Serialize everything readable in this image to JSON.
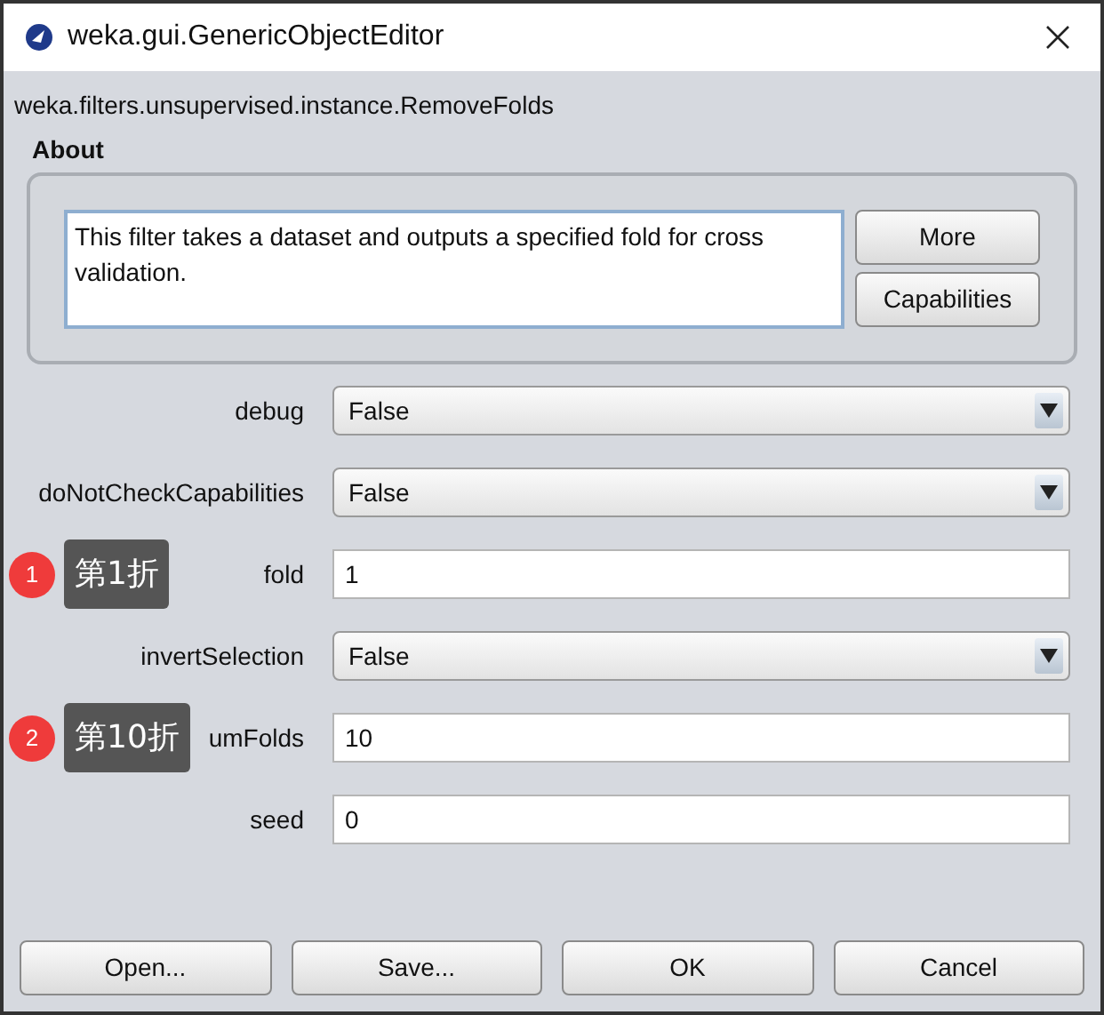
{
  "window": {
    "title": "weka.gui.GenericObjectEditor"
  },
  "class_name": "weka.filters.unsupervised.instance.RemoveFolds",
  "about": {
    "heading": "About",
    "description": "This filter takes a dataset and outputs a specified fold for cross validation.",
    "buttons": [
      "More",
      "Capabilities"
    ]
  },
  "properties": [
    {
      "label": "debug",
      "kind": "dropdown",
      "value": "False"
    },
    {
      "label": "doNotCheckCapabilities",
      "kind": "dropdown",
      "value": "False"
    },
    {
      "label": "fold",
      "kind": "text",
      "value": "1",
      "annotation": {
        "number": "1",
        "text": "第1折"
      }
    },
    {
      "label": "invertSelection",
      "kind": "dropdown",
      "value": "False"
    },
    {
      "label": "umFolds",
      "kind": "text",
      "value": "10",
      "annotation": {
        "number": "2",
        "text": "第10折"
      }
    },
    {
      "label": "seed",
      "kind": "text",
      "value": "0"
    }
  ],
  "buttons": [
    "Open...",
    "Save...",
    "OK",
    "Cancel"
  ]
}
